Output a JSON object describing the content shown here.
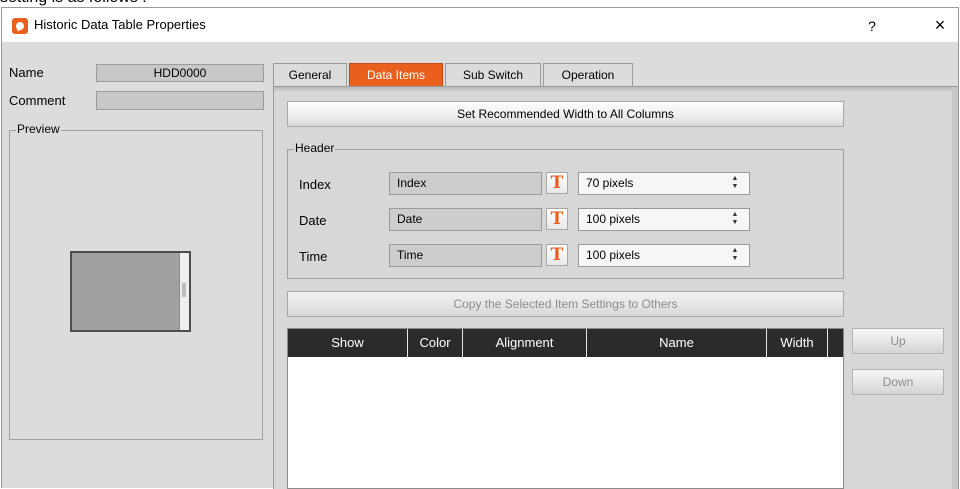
{
  "caption_top": "setting is as follows :",
  "window": {
    "title": "Historic Data Table Properties",
    "help": "?",
    "close": "×"
  },
  "left": {
    "name_label": "Name",
    "name_value": "HDD0000",
    "comment_label": "Comment",
    "comment_value": "",
    "preview_label": "Preview"
  },
  "tabs": [
    {
      "label": "General",
      "active": false
    },
    {
      "label": "Data Items",
      "active": true
    },
    {
      "label": "Sub Switch",
      "active": false
    },
    {
      "label": "Operation",
      "active": false
    }
  ],
  "set_width_button": "Set Recommended Width to All Columns",
  "header_group": {
    "title": "Header",
    "rows": [
      {
        "label": "Index",
        "value": "Index",
        "width": "70 pixels"
      },
      {
        "label": "Date",
        "value": "Date",
        "width": "100 pixels"
      },
      {
        "label": "Time",
        "value": "Time",
        "width": "100 pixels"
      }
    ]
  },
  "copy_button": "Copy the Selected Item Settings to Others",
  "table": {
    "columns": [
      "Show",
      "Color",
      "Alignment",
      "Name",
      "Width"
    ]
  },
  "side_buttons": {
    "up": "Up",
    "down": "Down"
  },
  "text_icon_glyph": "T",
  "colors": {
    "accent": "#e8601c",
    "table_header": "#2b2b2b",
    "dialog_bg": "#dcdcdc"
  }
}
